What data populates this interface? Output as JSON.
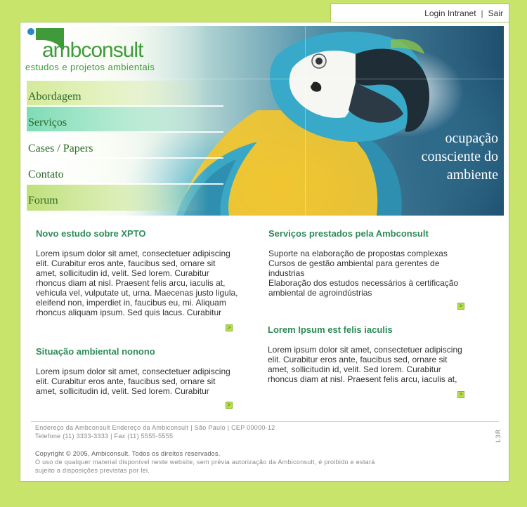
{
  "top_bar": {
    "login": "Login Intranet",
    "separator": "|",
    "logout": "Sair"
  },
  "logo": {
    "brand": "ambconsult",
    "tagline": "estudos e projetos ambientais"
  },
  "nav": {
    "items": [
      {
        "label": "Abordagem"
      },
      {
        "label": "Serviços"
      },
      {
        "label": "Cases / Papers"
      },
      {
        "label": "Contato"
      },
      {
        "label": "Forum"
      }
    ],
    "active_index": 1
  },
  "hero": {
    "slogan_lines": [
      "ocupação",
      "consciente do",
      "ambiente"
    ]
  },
  "articles": {
    "left_1": {
      "title": "Novo estudo sobre XPTO",
      "lines": [
        "Lorem ipsum dolor sit amet, consectetuer adipiscing",
        "elit. Curabitur eros ante, faucibus sed, ornare sit",
        "amet, sollicitudin id, velit. Sed lorem. Curabitur",
        "rhoncus diam at nisl. Praesent felis arcu, iaculis at,",
        "vehicula vel, vulputate ut, urna. Maecenas justo ligula,",
        "eleifend non, imperdiet in, faucibus eu, mi. Aliquam",
        "rhoncus aliquam ipsum. Sed quis lacus. Curabitur"
      ]
    },
    "left_2": {
      "title": "Situação ambiental nonono",
      "lines": [
        "Lorem ipsum dolor sit amet, consectetuer adipiscing",
        "elit. Curabitur eros ante, faucibus sed, ornare sit",
        "amet, sollicitudin id, velit. Sed lorem. Curabitur"
      ]
    },
    "right_1": {
      "title": "Serviços prestados pela Ambconsult",
      "lines": [
        "Suporte na elaboração de propostas complexas",
        "Cursos de gestão ambiental para gerentes de",
        "industrias",
        "Elaboração dos estudos necessários à certificação",
        "ambiental de agroindústrias"
      ]
    },
    "right_2": {
      "title": "Lorem Ipsum est felis iaculis",
      "lines": [
        "Lorem ipsum dolor sit amet, consectetuer adipiscing",
        "elit. Curabitur eros ante, faucibus sed, ornare sit",
        "amet, sollicitudin id, velit. Sed lorem. Curabitur",
        "rhoncus diam at nisl. Praesent felis arcu, iaculis at,"
      ]
    },
    "more_glyph": ">"
  },
  "footer": {
    "address": "Endereço da Ambconsult Endereço da Ambiconsult  |  São Paulo | CEP 00000-12",
    "phones": "Telefone (11) 3333-3333  |  Fax (11) 5555-5555",
    "copyright": "Copyright © 2005, Ambiconsult. Todos os direitos reservados.",
    "disclaimer_1": "O uso de qualquer material disponível neste website, sem prévia autorização da Ambiconsult, é proibido e estará",
    "disclaimer_2": "sujeito a disposições previstas por lei.",
    "credit": "L3R"
  },
  "colors": {
    "background": "#c8e46a",
    "brand_green": "#3f9b3a",
    "heading_green": "#2e8b5a",
    "arrow_bg": "#b7de4a"
  }
}
